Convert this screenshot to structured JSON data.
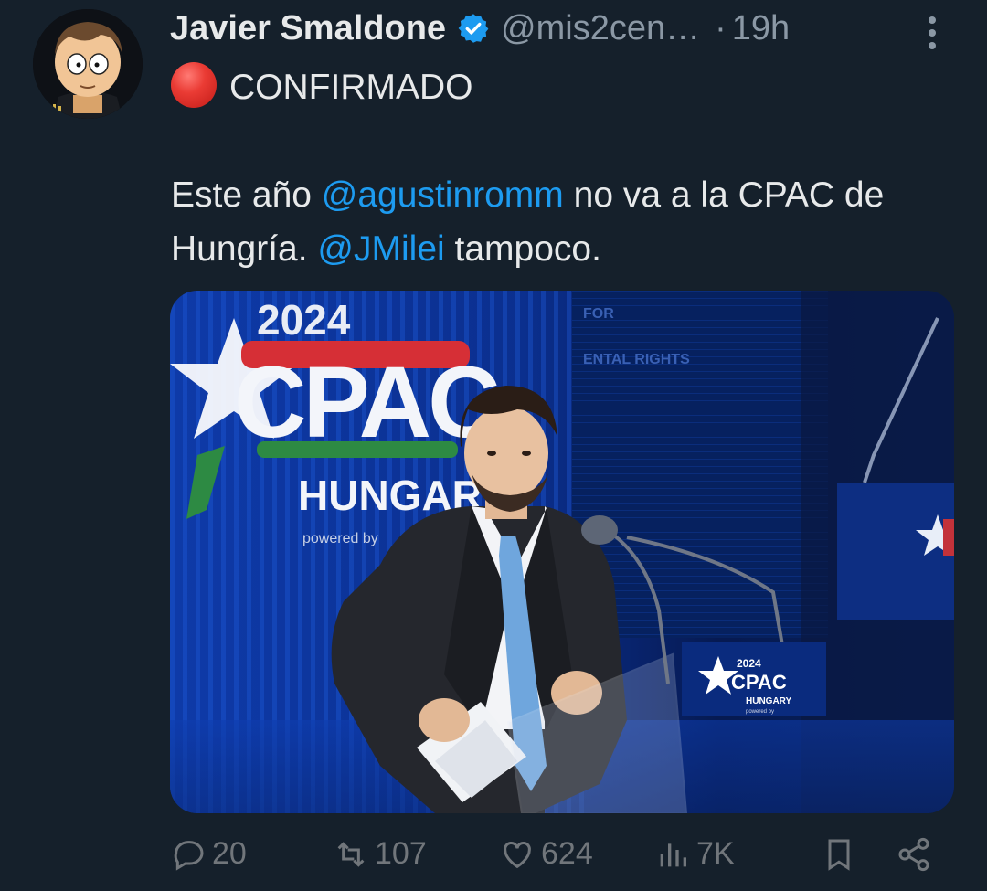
{
  "tweet": {
    "author_name": "Javier Smaldone",
    "author_handle": "@mis2cen…",
    "separator": "·",
    "time": "19h",
    "text": {
      "line1": "CONFIRMADO",
      "line2_part1": "Este año ",
      "mention1": "@agustinromm",
      "line2_part2": " no va a la CPAC de Hungría. ",
      "mention2": "@JMilei",
      "line2_part3": " tampoco."
    },
    "image_texts": {
      "year": "2024",
      "logo": "CPAC",
      "country": "HUNGARY",
      "powered": "powered by",
      "screen_text_1": "FOR",
      "screen_text_2": "ENTAL RIGHTS",
      "podium_year": "2024",
      "podium_logo": "CPAC",
      "podium_country": "HUNGARY",
      "podium_powered": "powered by"
    }
  },
  "actions": {
    "reply_count": "20",
    "retweet_count": "107",
    "like_count": "624",
    "views_count": "7K"
  },
  "icons": [
    "verified-badge-icon",
    "more-options-icon",
    "red-circle-emoji-icon",
    "reply-icon",
    "retweet-icon",
    "like-icon",
    "views-icon",
    "bookmark-icon",
    "share-icon"
  ],
  "colors": {
    "background": "#15202b",
    "text": "#e7e9ea",
    "secondary": "#8b98a5",
    "link": "#1d9bf0",
    "action": "#71767b"
  }
}
